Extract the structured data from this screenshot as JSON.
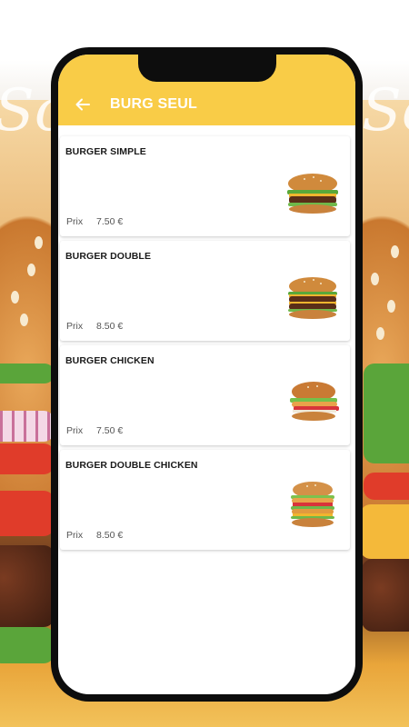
{
  "appbar": {
    "title": "BURG SEUL",
    "back_icon": "arrow-left-icon"
  },
  "background": {
    "script_left": "Sou",
    "script_right": "So"
  },
  "colors": {
    "appbar": "#f9cc47",
    "frame": "#0d0d0d"
  },
  "products": [
    {
      "name": "BURGER SIMPLE",
      "price_label": "Prix",
      "price": "7.50 €",
      "image": "single-burger-image"
    },
    {
      "name": "BURGER DOUBLE",
      "price_label": "Prix",
      "price": "8.50 €",
      "image": "double-burger-image"
    },
    {
      "name": "BURGER CHICKEN",
      "price_label": "Prix",
      "price": "7.50 €",
      "image": "chicken-burger-image"
    },
    {
      "name": "BURGER DOUBLE CHICKEN",
      "price_label": "Prix",
      "price": "8.50 €",
      "image": "double-chicken-burger-image"
    }
  ]
}
